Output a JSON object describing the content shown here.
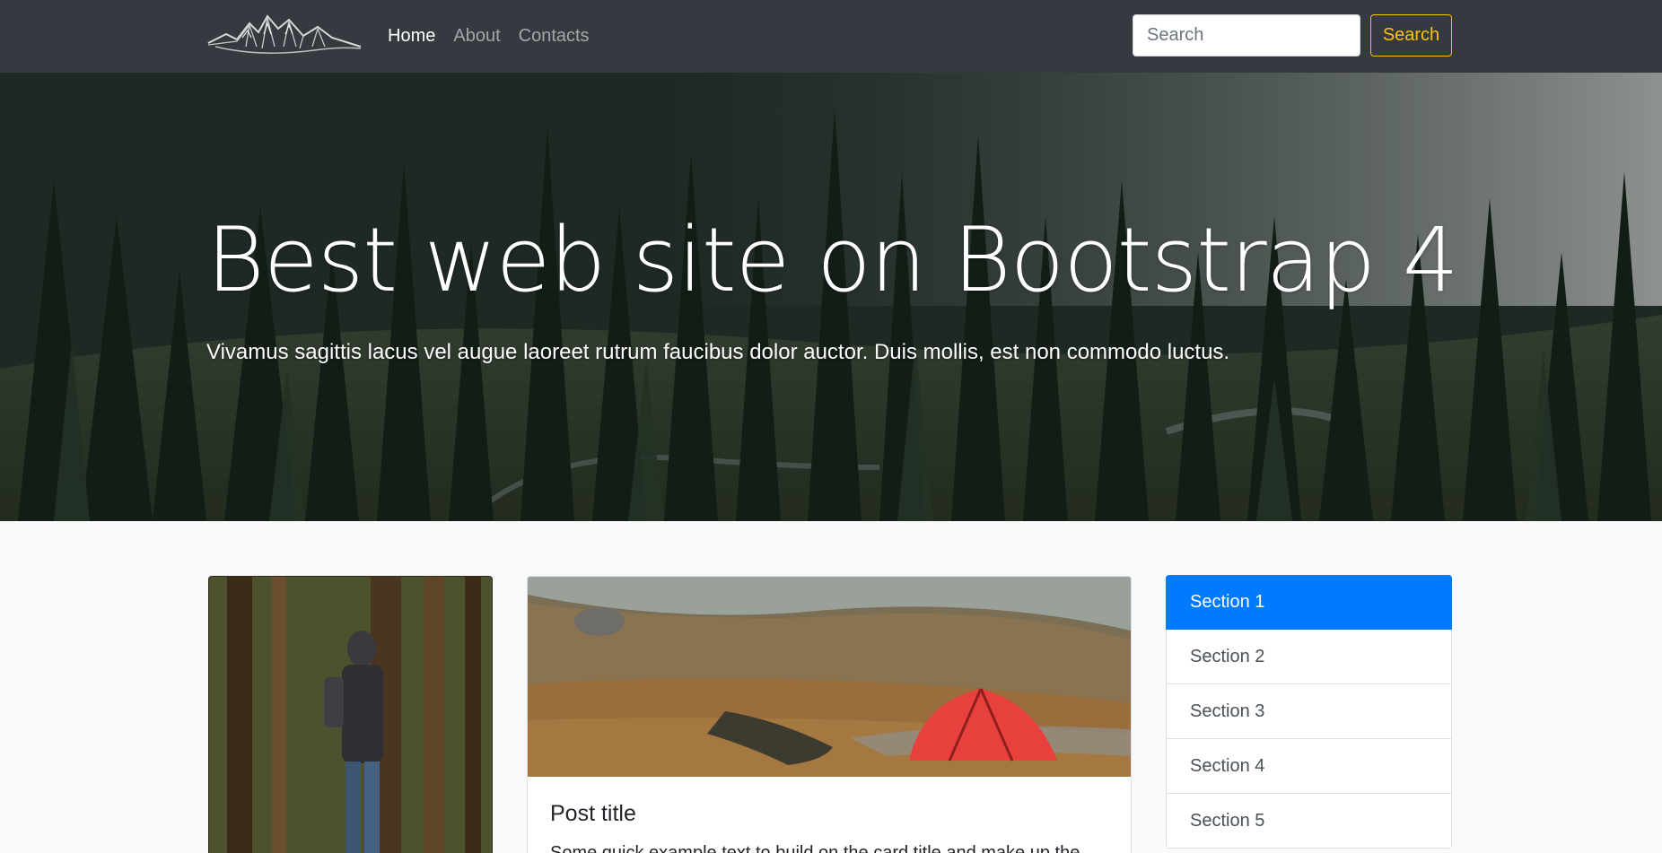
{
  "navbar": {
    "brand": "mountains-logo-icon",
    "links": [
      {
        "label": "Home",
        "active": true
      },
      {
        "label": "About",
        "active": false
      },
      {
        "label": "Contacts",
        "active": false
      }
    ],
    "search": {
      "placeholder": "Search",
      "value": "",
      "button_label": "Search"
    }
  },
  "hero": {
    "title": "Best web site on Bootstrap 4",
    "lead": "Vivamus sagittis lacus vel augue laoreet rutrum faucibus dolor auctor. Duis mollis, est non commodo luctus."
  },
  "cards": {
    "photo": {
      "image": "hiker-in-forest-image"
    },
    "post": {
      "image": "red-tent-in-mountain-valley-image",
      "title": "Post title",
      "text": "Some quick example text to build on the card title and make up the"
    }
  },
  "sidebar": {
    "items": [
      {
        "label": "Section 1",
        "active": true
      },
      {
        "label": "Section 2",
        "active": false
      },
      {
        "label": "Section 3",
        "active": false
      },
      {
        "label": "Section 4",
        "active": false
      },
      {
        "label": "Section 5",
        "active": false
      }
    ]
  },
  "colors": {
    "navbar_bg": "#343a40",
    "accent_warning": "#ffc107",
    "primary": "#007bff",
    "page_bg": "#f8f9fa"
  }
}
